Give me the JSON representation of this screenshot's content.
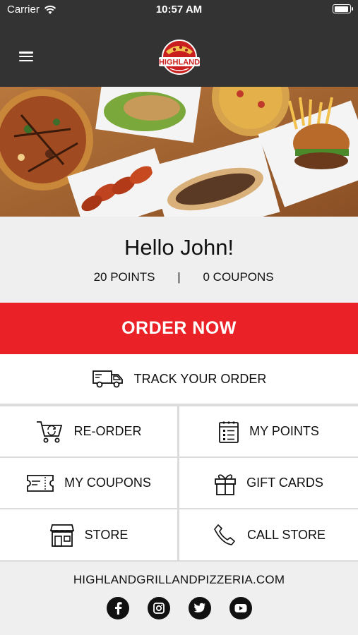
{
  "status_bar": {
    "carrier": "Carrier",
    "time": "10:57 AM"
  },
  "header": {
    "logo_text": "HIGHLAND"
  },
  "greeting": {
    "hello": "Hello John!",
    "points": "20 POINTS",
    "separator": "|",
    "coupons": "0 COUPONS"
  },
  "actions": {
    "order_now": "ORDER NOW",
    "track_order": "TRACK YOUR ORDER",
    "reorder": "RE-ORDER",
    "my_points": "MY POINTS",
    "my_coupons": "MY COUPONS",
    "gift_cards": "GIFT CARDS",
    "store": "STORE",
    "call_store": "CALL STORE"
  },
  "footer": {
    "website": "HIGHLANDGRILLANDPIZZERIA.COM"
  },
  "colors": {
    "header_bg": "#333333",
    "accent_red": "#ea2127",
    "panel_gray": "#efefef"
  }
}
